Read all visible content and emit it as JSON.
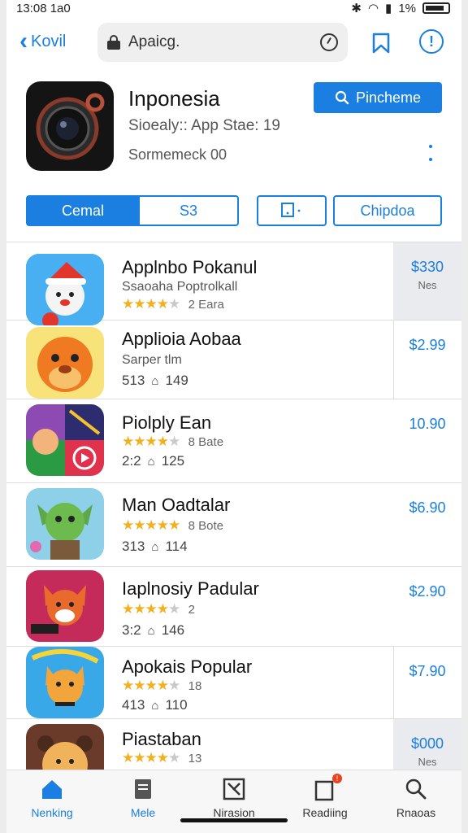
{
  "status_bar": {
    "time": "13:08 1a0",
    "battery": "1%"
  },
  "nav": {
    "back_label": "Kovil",
    "search_text": "Apaicg."
  },
  "app": {
    "title": "Inponesia",
    "subtitle": "Sioealy:: App Stae: 19",
    "meta": "Sormemeck 00",
    "primary_button": "Pinchemе"
  },
  "segments": [
    "Cemal",
    "S3",
    "",
    "Chipdoa"
  ],
  "list": [
    {
      "name": "Applnbo Pokanul",
      "sub": "Ssaoaha Poptrolkall",
      "stars": 4,
      "rating": "2 Eara",
      "meta": "",
      "price": "$330",
      "note": "Nes",
      "shaded": true
    },
    {
      "name": "Applioia Aobaa",
      "sub": "Sarper tlm",
      "stars": 0,
      "rating": "",
      "meta_left": "513",
      "meta_right": "149",
      "price": "$2.99",
      "note": "",
      "shaded": false
    },
    {
      "name": "Piolply Ean",
      "sub": "",
      "stars": 4,
      "rating": "8 Bate",
      "meta_left": "2:2",
      "meta_right": "125",
      "price": "10.90",
      "note": "",
      "shaded": false
    },
    {
      "name": "Man Oadtalar",
      "sub": "",
      "stars": 5,
      "rating": "8 Bote",
      "meta_left": "313",
      "meta_right": "114",
      "price": "$6.90",
      "note": "",
      "shaded": false
    },
    {
      "name": "Iaplnosiy Padular",
      "sub": "",
      "stars": 4,
      "rating": "2",
      "meta_left": "3:2",
      "meta_right": "146",
      "price": "$2.90",
      "note": "",
      "shaded": false
    },
    {
      "name": "Apokais Popular",
      "sub": "",
      "stars": 4,
      "rating": "18",
      "meta_left": "413",
      "meta_right": "110",
      "price": "$7.90",
      "note": "",
      "shaded": false
    },
    {
      "name": "Piastaban",
      "sub": "",
      "stars": 4,
      "rating": "13",
      "meta_left": "",
      "meta_right": "",
      "price": "$000",
      "note": "Nes",
      "shaded": true
    }
  ],
  "tabs": [
    {
      "label": "Nenking",
      "icon": "home-icon"
    },
    {
      "label": "Mele",
      "icon": "document-icon"
    },
    {
      "label": "Nirasion",
      "icon": "tools-icon"
    },
    {
      "label": "Readiing",
      "icon": "notifications-icon"
    },
    {
      "label": "Rnaoas",
      "icon": "search-icon"
    }
  ],
  "colors": {
    "accent": "#1a7fe0",
    "star": "#f2b01e",
    "badge": "#e8421e"
  }
}
